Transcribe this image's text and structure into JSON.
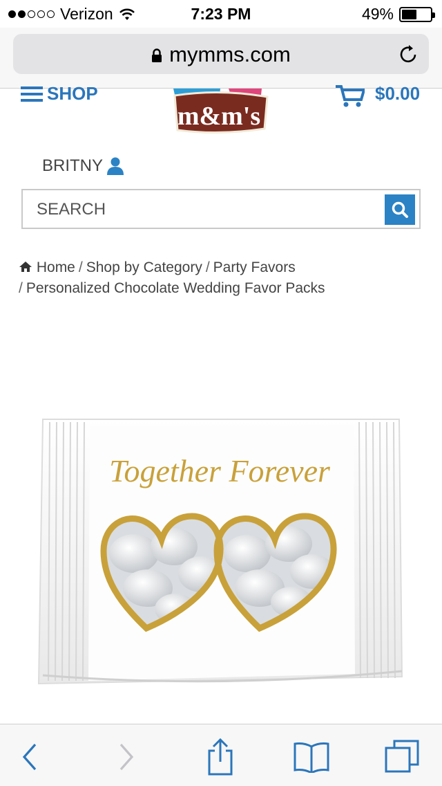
{
  "status_bar": {
    "carrier": "Verizon",
    "time": "7:23 PM",
    "battery_percent": "49%",
    "battery_level": 0.49,
    "signal_bars_filled": 2,
    "signal_bars_total": 5
  },
  "browser": {
    "domain": "mymms.com"
  },
  "header": {
    "menu_label": "SHOP",
    "logo_text": "m&m's",
    "cart_total": "$0.00"
  },
  "account": {
    "username": "BRITNY"
  },
  "search": {
    "placeholder": "SEARCH"
  },
  "breadcrumb": {
    "items": [
      "Home",
      "Shop by Category",
      "Party Favors",
      "Personalized Chocolate Wedding Favor Packs"
    ],
    "separator": "/"
  },
  "product": {
    "package_text": "Together Forever"
  },
  "colors": {
    "accent": "#2b76bb",
    "search_button": "#2b82c4",
    "gold": "#c9a13a"
  },
  "icons": [
    "signal-dots-icon",
    "wifi-icon",
    "battery-icon",
    "lock-icon",
    "reload-icon",
    "menu-icon",
    "cart-icon",
    "user-icon",
    "search-icon",
    "home-icon",
    "back-icon",
    "forward-icon",
    "share-icon",
    "bookmarks-icon",
    "tabs-icon"
  ]
}
